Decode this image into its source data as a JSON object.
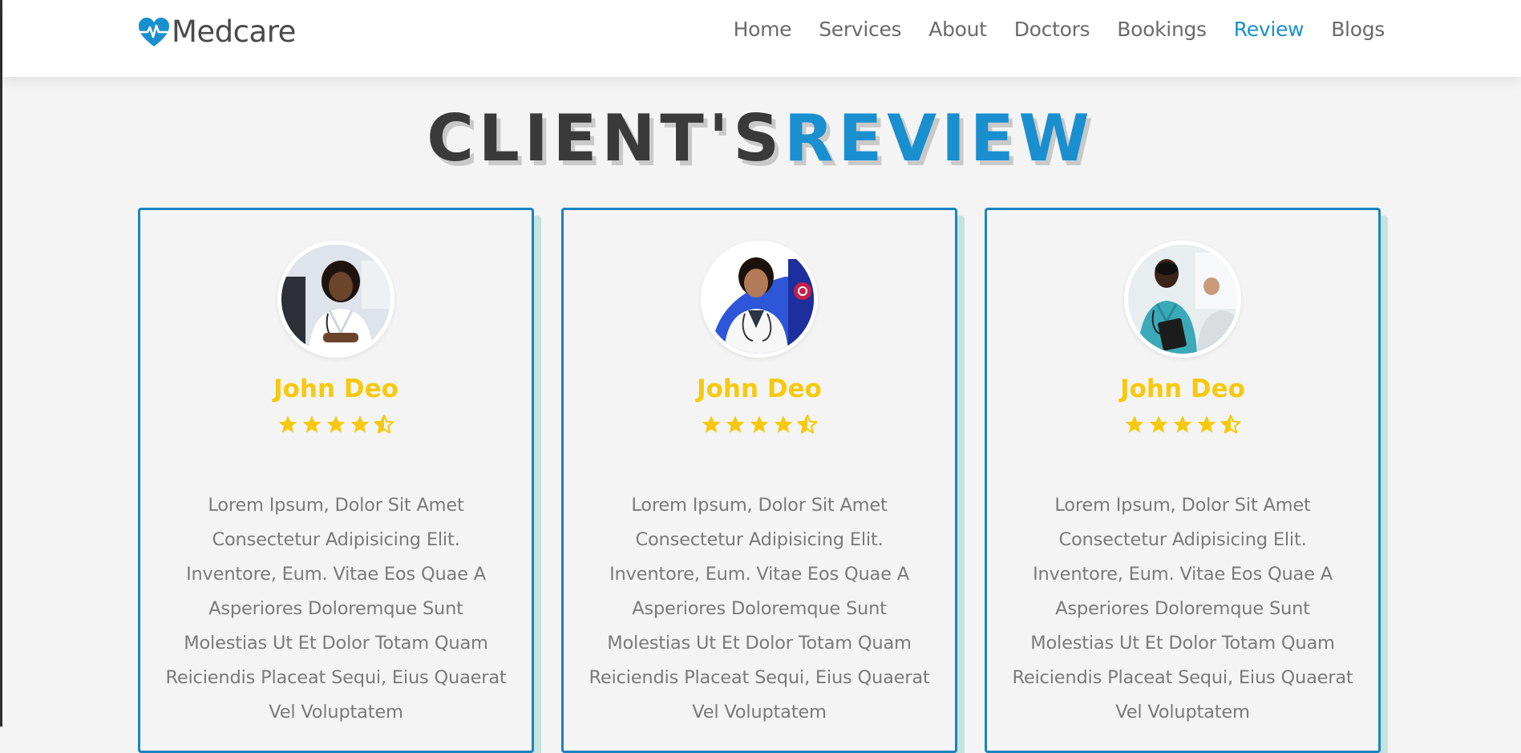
{
  "brand": {
    "name": "Medcare",
    "accent": "#1a8fcf",
    "icon": "heartbeat-icon"
  },
  "nav": [
    {
      "label": "Home",
      "active": false
    },
    {
      "label": "Services",
      "active": false
    },
    {
      "label": "About",
      "active": false
    },
    {
      "label": "Doctors",
      "active": false
    },
    {
      "label": "Bookings",
      "active": false
    },
    {
      "label": "Review",
      "active": true
    },
    {
      "label": "Blogs",
      "active": false
    }
  ],
  "section": {
    "title_part1": "CLIENT'S",
    "title_part2": "REVIEW"
  },
  "reviews": [
    {
      "name": "John Deo",
      "rating": 4.5,
      "avatar": "doctor-photo-1",
      "text": "Lorem Ipsum, Dolor Sit Amet Consectetur Adipisicing Elit. Inventore, Eum. Vitae Eos Quae A Asperiores Doloremque Sunt Molestias Ut Et Dolor Totam Quam Reiciendis Placeat Sequi, Eius Quaerat Vel Voluptatem"
    },
    {
      "name": "John Deo",
      "rating": 4.5,
      "avatar": "doctor-photo-2",
      "text": "Lorem Ipsum, Dolor Sit Amet Consectetur Adipisicing Elit. Inventore, Eum. Vitae Eos Quae A Asperiores Doloremque Sunt Molestias Ut Et Dolor Totam Quam Reiciendis Placeat Sequi, Eius Quaerat Vel Voluptatem"
    },
    {
      "name": "John Deo",
      "rating": 4.5,
      "avatar": "doctor-photo-3",
      "text": "Lorem Ipsum, Dolor Sit Amet Consectetur Adipisicing Elit. Inventore, Eum. Vitae Eos Quae A Asperiores Doloremque Sunt Molestias Ut Et Dolor Totam Quam Reiciendis Placeat Sequi, Eius Quaerat Vel Voluptatem"
    }
  ],
  "colors": {
    "name": "#f6c90e",
    "star": "#f6c90e",
    "card_border": "#1a84bf",
    "card_shadow": "#c4e3df"
  }
}
